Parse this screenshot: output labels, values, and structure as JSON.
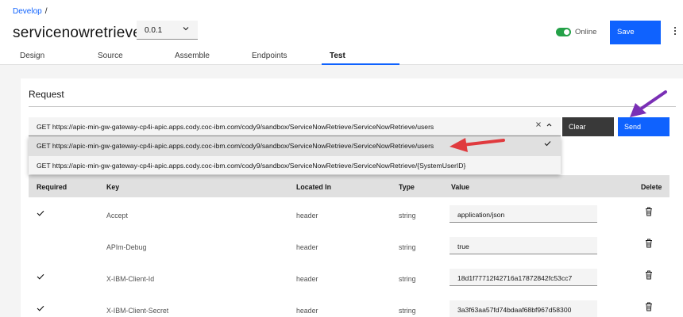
{
  "breadcrumb": {
    "root": "Develop",
    "separator": "/"
  },
  "api": {
    "title": "servicenowretrieve",
    "version": "0.0.1"
  },
  "status": {
    "online_label": "Online",
    "color": "#24a148"
  },
  "toolbar": {
    "save_label": "Save",
    "more_icon": "overflow-menu-icon"
  },
  "tabs": [
    {
      "label": "Design"
    },
    {
      "label": "Source"
    },
    {
      "label": "Assemble"
    },
    {
      "label": "Endpoints"
    },
    {
      "label": "Test",
      "active": true
    }
  ],
  "request": {
    "title": "Request",
    "selected_url": "GET https://apic-min-gw-gateway-cp4i-apic.apps.cody.coc-ibm.com/cody9/sandbox/ServiceNowRetrieve/ServiceNowRetrieve/users",
    "clear_label": "Clear",
    "send_label": "Send",
    "options": [
      "GET https://apic-min-gw-gateway-cp4i-apic.apps.cody.coc-ibm.com/cody9/sandbox/ServiceNowRetrieve/ServiceNowRetrieve/users",
      "GET https://apic-min-gw-gateway-cp4i-apic.apps.cody.coc-ibm.com/cody9/sandbox/ServiceNowRetrieve/ServiceNowRetrieve/{SystemUserID}"
    ]
  },
  "table": {
    "headers": {
      "required": "Required",
      "key": "Key",
      "located_in": "Located In",
      "type": "Type",
      "value": "Value",
      "delete": "Delete"
    },
    "rows": [
      {
        "required": true,
        "key": "Accept",
        "located_in": "header",
        "type": "string",
        "value": "application/json"
      },
      {
        "required": false,
        "key": "APIm-Debug",
        "located_in": "header",
        "type": "string",
        "value": "true"
      },
      {
        "required": true,
        "key": "X-IBM-Client-Id",
        "located_in": "header",
        "type": "string",
        "value": "18d1f77712f42716a17872842fc53cc7"
      },
      {
        "required": true,
        "key": "X-IBM-Client-Secret",
        "located_in": "header",
        "type": "string",
        "value": "3a3f63aa57fd74bdaaf68bf967d58300"
      }
    ]
  },
  "colors": {
    "accent": "#0f62fe",
    "annotation_red": "#e03a3e",
    "annotation_purple": "#7a2fb5"
  }
}
